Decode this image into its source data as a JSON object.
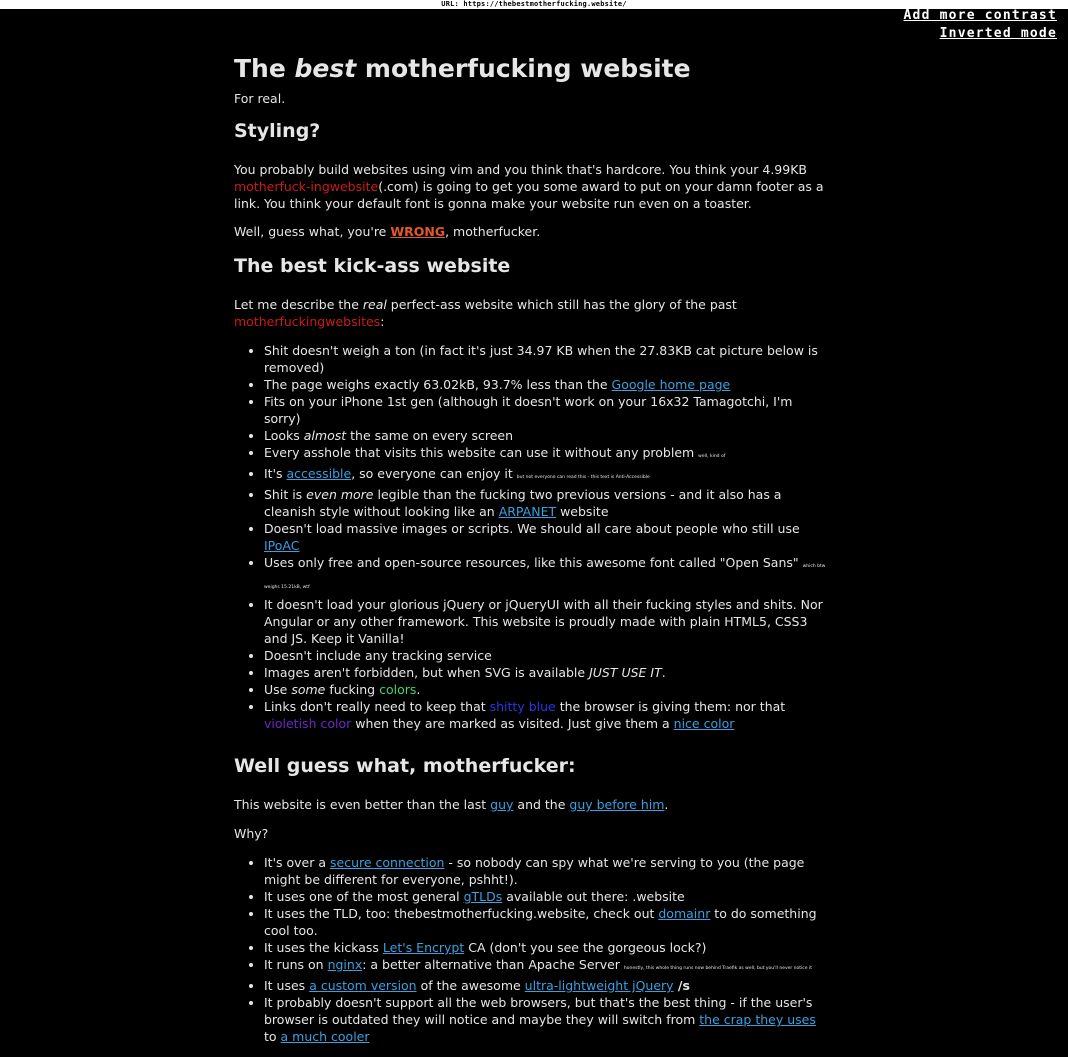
{
  "url_bar": "URL: https://thebestmotherfucking.website/",
  "toggles": {
    "contrast": "Add more contrast",
    "inverted": "Inverted mode"
  },
  "title": {
    "pre": "The ",
    "em": "best",
    "post": " motherfucking website"
  },
  "subtitle": "For real.",
  "styling": {
    "heading": "Styling?",
    "p1_a": "You probably build websites using vim and you think that's hardcore. You think your 4.99KB ",
    "p1_link": "motherfuck-ingwebsite",
    "p1_b": "(.com) is going to get you some award to put on your damn footer as a link. You think your default font is gonna make your website run even on a toaster.",
    "p2_a": "Well, guess what, you're ",
    "p2_wrong": "WRONG",
    "p2_b": ", motherfucker."
  },
  "kickass": {
    "heading": "The best kick-ass website",
    "intro_a": "Let me describe the ",
    "intro_em": "real",
    "intro_b": " perfect-ass website which still has the glory of the past ",
    "intro_link": "motherfuckingwebsites",
    "intro_c": ":",
    "items": [
      {
        "t": "Shit doesn't weigh a ton (in fact it's just 34.97 KB when the 27.83KB cat picture below is removed)"
      },
      {
        "a": "The page weighs exactly 63.02kB, 93.7% less than the ",
        "link": "Google home page"
      },
      {
        "t": "Fits on your iPhone 1st gen (although it doesn't work on your 16x32 Tamagotchi, I'm sorry)"
      },
      {
        "a": "Looks ",
        "em": "almost",
        "b": " the same on every screen"
      },
      {
        "a": "Every asshole that visits this website can use it without any problem ",
        "tiny": "well, kind of"
      },
      {
        "a": "It's ",
        "link": "accessible",
        "b": ", so everyone can enjoy it ",
        "tiny": "but not everyone can read this - this text is Anti-Accessible"
      },
      {
        "a": "Shit is ",
        "em": "even more",
        "b": " legible than the fucking two previous versions - and it also has a cleanish style without looking like an ",
        "link": "ARPANET",
        "c": " website"
      },
      {
        "a": "Doesn't load massive images or scripts. We should all care about people who still use ",
        "link": "IPoAC"
      },
      {
        "a": "Uses only free and open-source resources, like this awesome font called \"Open Sans\" ",
        "tiny": "which btw weighs 15.21kB, wtf"
      },
      {
        "t": "It doesn't load your glorious jQuery or jQueryUI with all their fucking styles and shits. Nor Angular or any other framework. This website is proudly made with plain HTML5, CSS3 and JS. Keep it Vanilla!"
      },
      {
        "t": "Doesn't include any tracking service"
      },
      {
        "a": "Images aren't forbidden, but when SVG is available ",
        "em": "JUST USE IT",
        "b": "."
      },
      {
        "a": "Use ",
        "em": "some",
        "b": " fucking ",
        "green": "colors",
        "c": "."
      },
      {
        "a": "Links don't really need to keep that ",
        "blue": "shitty blue",
        "b": " the browser is giving them: nor that ",
        "violet": "violetish color",
        "c": " when they are marked as visited. Just give them a ",
        "link": "nice color"
      }
    ]
  },
  "guess": {
    "heading": "Well guess what, motherfucker:",
    "p1_a": "This website is even better than the last ",
    "p1_link1": "guy",
    "p1_b": " and the ",
    "p1_link2": "guy before him",
    "p1_c": ".",
    "why": "Why?",
    "items": [
      {
        "a": "It's over a ",
        "link": "secure connection",
        "b": " - so nobody can spy what we're serving to you (the page might be different for everyone, pshht!)."
      },
      {
        "a": "It uses one of the most general ",
        "link": "gTLDs",
        "b": " available out there: .website"
      },
      {
        "a": "It uses the TLD, too: thebestmotherfucking.website, check out ",
        "link": "domainr",
        "b": " to do something cool too."
      },
      {
        "a": "It uses the kickass ",
        "link": "Let's Encrypt",
        "b": " CA (don't you see the gorgeous lock?)"
      },
      {
        "a": "It runs on ",
        "link": "nginx",
        "b": ": a better alternative than Apache Server ",
        "tiny": "honestly, this whole thing runs now behind Traefik as well, but you'll never notice it"
      },
      {
        "a": "It uses ",
        "link": "a custom version",
        "b": " of the awesome ",
        "link2": "ultra-lightweight jQuery",
        "slash": " /s"
      },
      {
        "a": "It probably doesn't support all the web browsers, but that's the best thing - if the user's browser is outdated they will notice and maybe they will switch from ",
        "link": "the crap they uses",
        "b": " to ",
        "link2": "a much cooler"
      }
    ]
  }
}
